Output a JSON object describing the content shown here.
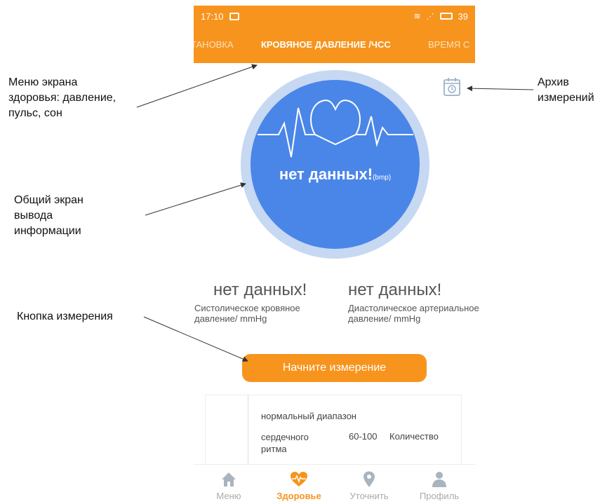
{
  "status_bar": {
    "time": "17:10",
    "battery": "39"
  },
  "tabs": [
    {
      "label": "ТАНОВКА"
    },
    {
      "label": "КРОВЯНОЕ ДАВЛЕНИЕ /ЧСС"
    },
    {
      "label": "ВРЕМЯ С"
    }
  ],
  "gauge": {
    "value": "нет данных!",
    "unit": "(bmp)"
  },
  "metrics": [
    {
      "value": "нет данных!",
      "label": "Систолическое кровяное давление/ mmHg"
    },
    {
      "value": "нет данных!",
      "label": "Диастолическое артериальное давление/ mmHg"
    }
  ],
  "start_button": "Начните измерение",
  "range": {
    "title": "нормальный диапазон",
    "label": "сердечного ритма",
    "values": "60-100",
    "count": "Количество"
  },
  "nav": [
    {
      "label": "Меню",
      "icon": "home-icon"
    },
    {
      "label": "Здоровье",
      "icon": "heart-icon"
    },
    {
      "label": "Уточнить",
      "icon": "location-icon"
    },
    {
      "label": "Профиль",
      "icon": "profile-icon"
    }
  ],
  "annotations": {
    "menu": "Меню экрана здоровья: давление, пульс, сон",
    "archive": "Архив измерений",
    "display": "Общий экран вывода информации",
    "button": "Кнопка измерения"
  },
  "colors": {
    "accent": "#f7941d",
    "gauge": "#4a86e8",
    "gauge_ring": "#c7d8f3"
  }
}
